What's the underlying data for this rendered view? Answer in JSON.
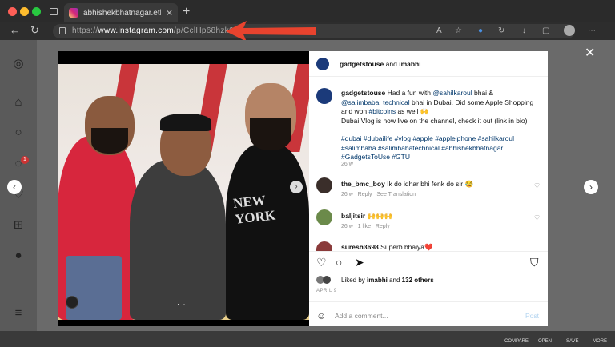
{
  "browser": {
    "tab_title": "abhishekbhatnagar.eth (@ima",
    "url_prefix": "https://",
    "url_domain": "www.instagram.com",
    "url_path": "/p/CclHp68hzk6/"
  },
  "post": {
    "header_user": "gadgetstouse",
    "header_and": "and",
    "header_collab": "imabhi",
    "caption_user": "gadgetstouse",
    "caption_line1": "Had a fun with",
    "caption_mention1": "@sahilkaroul",
    "caption_line1b": "bhai &",
    "caption_mention2": "@salimbaba_technical",
    "caption_line2": "bhai in Dubai. Did some Apple Shopping and won",
    "caption_tag_bitcoins": "#bitcoins",
    "caption_line3": "as well 🙌",
    "caption_line4": "Dubai Vlog is now live on the channel, check it out (link in bio)",
    "hashtags": "#dubai #dubailife #vlog #apple #appleiphone #sahilkaroul #salimbaba #salimbabatechnical #abhishekbhatnagar #GadgetsToUse #GTU",
    "caption_time": "26 w",
    "comments": [
      {
        "user": "the_bmc_boy",
        "text": "Ik do idhar bhi fenk do sir 😂",
        "time": "26 w",
        "reply": "Reply",
        "translate": "See Translation"
      },
      {
        "user": "baljitsir",
        "text": "🙌🙌🙌",
        "time": "26 w",
        "likes": "1 like",
        "reply": "Reply"
      },
      {
        "user": "suresh3698",
        "text": "Superb bhaiya❤️"
      }
    ],
    "liked_by_prefix": "Liked by",
    "liked_by_user": "imabhi",
    "liked_by_and": "and",
    "liked_by_others": "132 others",
    "date": "APRIL 9",
    "add_comment_placeholder": "Add a comment...",
    "post_button": "Post"
  },
  "taskbar": {
    "labels": [
      "COMPARE",
      "OPEN",
      "SAVE",
      "MORE"
    ]
  },
  "colors": {
    "arrow": "#e8432e",
    "link": "#00376b",
    "badge": "#cc3333"
  }
}
